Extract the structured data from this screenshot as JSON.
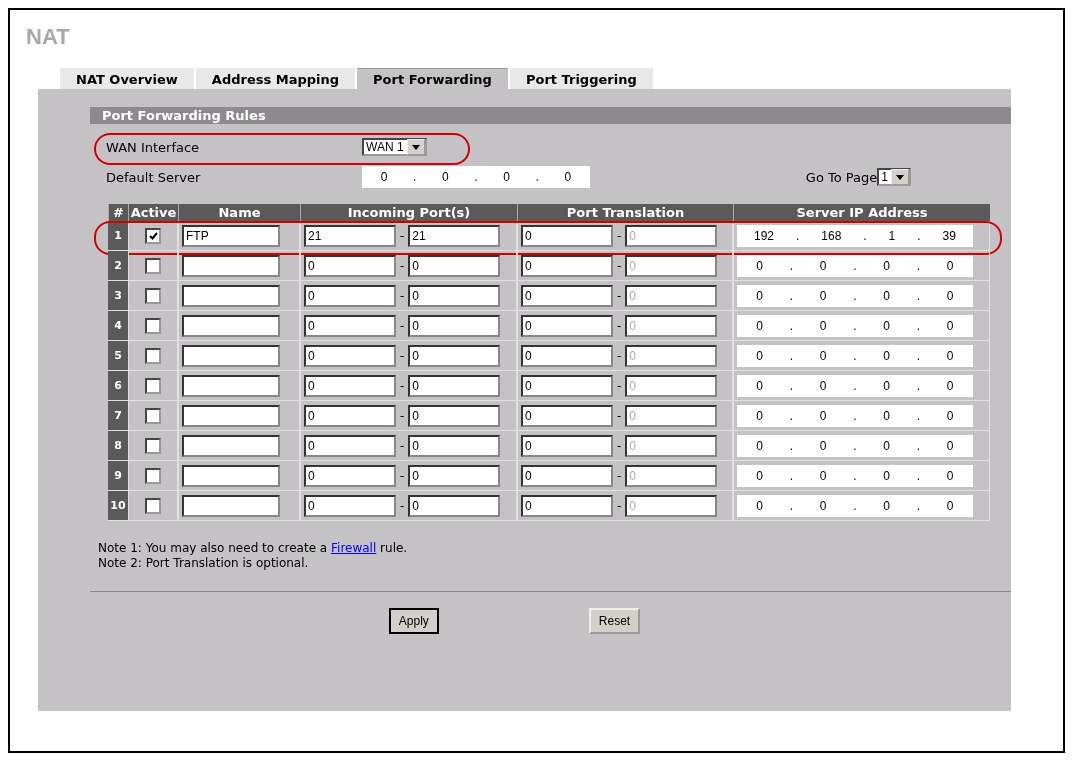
{
  "title": "NAT",
  "tabs": [
    {
      "label": "NAT Overview",
      "selected": false
    },
    {
      "label": "Address Mapping",
      "selected": false
    },
    {
      "label": "Port Forwarding",
      "selected": true
    },
    {
      "label": "Port Triggering",
      "selected": false
    }
  ],
  "section_title": "Port Forwarding Rules",
  "wan_interface": {
    "label": "WAN Interface",
    "value": "WAN 1",
    "highlighted": true
  },
  "default_server": {
    "label": "Default Server",
    "octets": [
      "0",
      "0",
      "0",
      "0"
    ]
  },
  "go_to_page": {
    "label": "Go To Page",
    "value": "1"
  },
  "table": {
    "columns": [
      "#",
      "Active",
      "Name",
      "Incoming Port(s)",
      "Port Translation",
      "Server IP Address"
    ],
    "range_separator": "-",
    "ip_separator": ".",
    "rows": [
      {
        "index": "1",
        "active": true,
        "highlighted": true,
        "name": "FTP",
        "incoming_start": "21",
        "incoming_end": "21",
        "translation_start": "0",
        "translation_end": "0",
        "translation_end_disabled": true,
        "ip": [
          "192",
          "168",
          "1",
          "39"
        ]
      },
      {
        "index": "2",
        "active": false,
        "highlighted": false,
        "name": "",
        "incoming_start": "0",
        "incoming_end": "0",
        "translation_start": "0",
        "translation_end": "0",
        "translation_end_disabled": true,
        "ip": [
          "0",
          "0",
          "0",
          "0"
        ]
      },
      {
        "index": "3",
        "active": false,
        "highlighted": false,
        "name": "",
        "incoming_start": "0",
        "incoming_end": "0",
        "translation_start": "0",
        "translation_end": "0",
        "translation_end_disabled": true,
        "ip": [
          "0",
          "0",
          "0",
          "0"
        ]
      },
      {
        "index": "4",
        "active": false,
        "highlighted": false,
        "name": "",
        "incoming_start": "0",
        "incoming_end": "0",
        "translation_start": "0",
        "translation_end": "0",
        "translation_end_disabled": true,
        "ip": [
          "0",
          "0",
          "0",
          "0"
        ]
      },
      {
        "index": "5",
        "active": false,
        "highlighted": false,
        "name": "",
        "incoming_start": "0",
        "incoming_end": "0",
        "translation_start": "0",
        "translation_end": "0",
        "translation_end_disabled": true,
        "ip": [
          "0",
          "0",
          "0",
          "0"
        ]
      },
      {
        "index": "6",
        "active": false,
        "highlighted": false,
        "name": "",
        "incoming_start": "0",
        "incoming_end": "0",
        "translation_start": "0",
        "translation_end": "0",
        "translation_end_disabled": true,
        "ip": [
          "0",
          "0",
          "0",
          "0"
        ]
      },
      {
        "index": "7",
        "active": false,
        "highlighted": false,
        "name": "",
        "incoming_start": "0",
        "incoming_end": "0",
        "translation_start": "0",
        "translation_end": "0",
        "translation_end_disabled": true,
        "ip": [
          "0",
          "0",
          "0",
          "0"
        ]
      },
      {
        "index": "8",
        "active": false,
        "highlighted": false,
        "name": "",
        "incoming_start": "0",
        "incoming_end": "0",
        "translation_start": "0",
        "translation_end": "0",
        "translation_end_disabled": true,
        "ip": [
          "0",
          "0",
          "0",
          "0"
        ]
      },
      {
        "index": "9",
        "active": false,
        "highlighted": false,
        "name": "",
        "incoming_start": "0",
        "incoming_end": "0",
        "translation_start": "0",
        "translation_end": "0",
        "translation_end_disabled": true,
        "ip": [
          "0",
          "0",
          "0",
          "0"
        ]
      },
      {
        "index": "10",
        "active": false,
        "highlighted": false,
        "name": "",
        "incoming_start": "0",
        "incoming_end": "0",
        "translation_start": "0",
        "translation_end": "0",
        "translation_end_disabled": true,
        "ip": [
          "0",
          "0",
          "0",
          "0"
        ]
      }
    ]
  },
  "notes": [
    {
      "before": "Note 1: You may also need to create a ",
      "link": "Firewall",
      "after": " rule."
    },
    {
      "before": "Note 2: Port Translation is optional."
    }
  ],
  "buttons": [
    {
      "label": "Apply",
      "default": true
    },
    {
      "label": "Reset",
      "default": false
    }
  ]
}
